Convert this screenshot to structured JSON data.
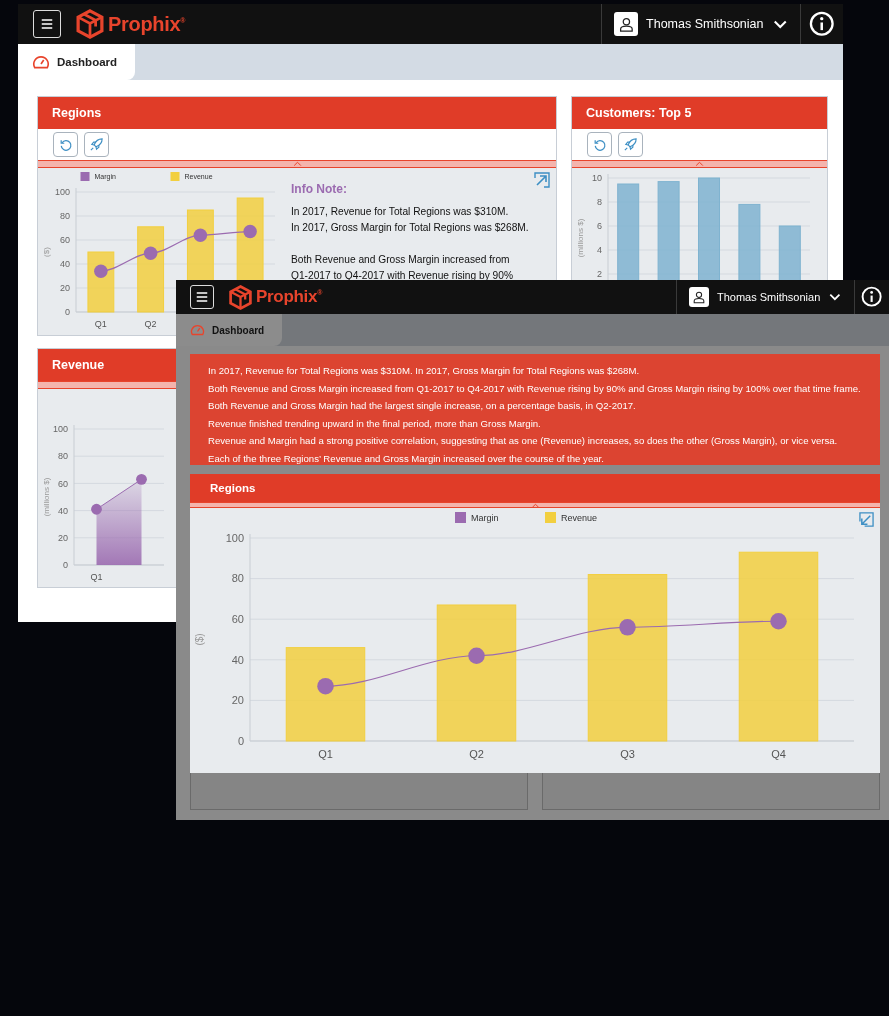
{
  "back_window": {
    "app_bar": {
      "logo": "Prophix$^{®}$",
      "user_name": "Thomas Smithsonian"
    },
    "tabs": [
      {
        "label": "Dashboard",
        "selected": true
      }
    ],
    "panels": [
      {
        "kind": "chart_note",
        "title": "Regions",
        "toolbar": true,
        "chart_data": {
          "type": "bar",
          "ylabel": "($)",
          "categories": [
            "Q1",
            "Q2",
            null,
            null
          ],
          "ylim": [
            0,
            100
          ],
          "yticks": [
            0,
            20,
            40,
            60,
            80,
            100
          ],
          "grid": true,
          "legend": "top",
          "series": [
            {
              "name": "Margin",
              "type": "line",
              "marker": true,
              "color": "#9b6bb0",
              "values": [
                34,
                49,
                64,
                67
              ]
            },
            {
              "name": "Revenue",
              "color": "#f2cf3f",
              "values": [
                50,
                71,
                85,
                95
              ]
            }
          ]
        },
        "info_note": {
          "heading": "Info Note:",
          "lines": [
            "In 2017, Revenue for Total Regions was $310M.",
            "In 2017, Gross Margin for Total Regions was $268M.",
            "Both Revenue and Gross Margin increased from",
            "Q1-2017 to Q4-2017 with Revenue rising by 90%"
          ]
        }
      },
      {
        "kind": "chart",
        "title": "Customers: Top 5",
        "toolbar": true,
        "chart_data": {
          "type": "bar",
          "ylabel": "(millions $)",
          "ylim": [
            0,
            10
          ],
          "yticks": [
            2,
            4,
            6,
            8,
            10
          ],
          "grid": true,
          "series": [
            {
              "color": "#7fb3d0",
              "values": [
                9.5,
                9.7,
                10,
                7.8,
                6
              ]
            }
          ]
        }
      },
      {
        "kind": "chart",
        "title": "Revenue",
        "toolbar": false,
        "chart_data": {
          "type": "area",
          "ylabel": "(millions $)",
          "categories": [
            "Q1",
            null
          ],
          "ylim": [
            0,
            100
          ],
          "yticks": [
            0,
            20,
            40,
            60,
            80,
            100
          ],
          "grid": true,
          "series": [
            {
              "color": "#9b6bb0",
              "marker": true,
              "values": [
                41,
                63
              ]
            }
          ]
        }
      }
    ]
  },
  "front_window": {
    "app_bar": {
      "logo": "Prophix$^{®}$",
      "user_name": "Thomas Smithsonian"
    },
    "tabs": [
      {
        "label": "Dashboard",
        "selected": true
      }
    ],
    "summary_lines": [
      "In 2017, Revenue for Total Regions was $310M. In 2017, Gross Margin for Total Regions was $268M.",
      "Both Revenue and Gross Margin increased from Q1-2017 to Q4-2017 with Revenue rising by 90% and Gross Margin rising by 100% over that time frame.",
      "Both Revenue and Gross Margin had the largest single increase, on a percentage basis, in Q2-2017.",
      "Revenue finished trending upward in the final period, more than Gross Margin.",
      "Revenue and Margin had a strong positive correlation, suggesting that as one (Revenue) increases, so does the other (Gross Margin), or vice versa.",
      "Each of the three Regions’ Revenue and Gross Margin increased over the course of the year."
    ],
    "panel": {
      "title": "Regions",
      "chart_data": {
        "type": "bar",
        "ylabel": "($)",
        "categories": [
          "Q1",
          "Q2",
          "Q3",
          "Q4"
        ],
        "ylim": [
          0,
          100
        ],
        "yticks": [
          0,
          20,
          40,
          60,
          80,
          100
        ],
        "grid": true,
        "legend": "top",
        "series": [
          {
            "name": "Margin",
            "type": "line",
            "marker": true,
            "color": "#9b6bb0",
            "values": [
              27,
              42,
              56,
              59
            ]
          },
          {
            "name": "Revenue",
            "color": "#f2cf3f",
            "values": [
              46,
              67,
              82,
              93
            ]
          }
        ]
      }
    }
  }
}
